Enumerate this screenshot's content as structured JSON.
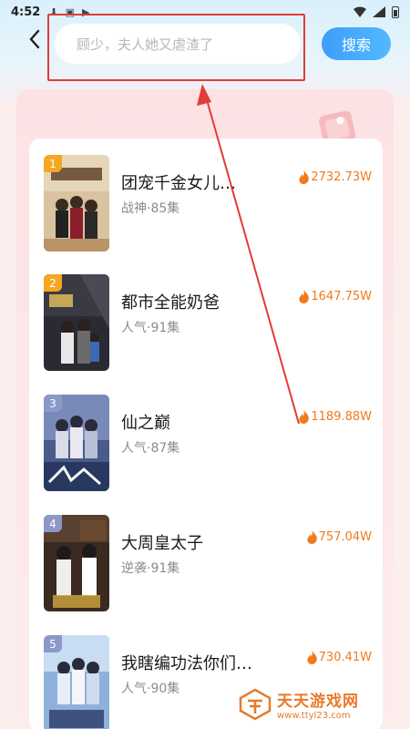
{
  "status_bar": {
    "time": "4:52"
  },
  "search": {
    "placeholder": "顾少，夫人她又虐渣了",
    "button_label": "搜索"
  },
  "ranking": [
    {
      "rank": "1",
      "title": "团宠千金女儿…",
      "meta": "战神·85集",
      "heat": "2732.73W",
      "badge_color": "#f5a623"
    },
    {
      "rank": "2",
      "title": "都市全能奶爸",
      "meta": "人气·91集",
      "heat": "1647.75W",
      "badge_color": "#f5a623"
    },
    {
      "rank": "3",
      "title": "仙之巅",
      "meta": "人气·87集",
      "heat": "1189.88W",
      "badge_color": "#8c98c8"
    },
    {
      "rank": "4",
      "title": "大周皇太子",
      "meta": "逆袭·91集",
      "heat": "757.04W",
      "badge_color": "#8c98c8"
    },
    {
      "rank": "5",
      "title": "我瞎编功法你们…",
      "meta": "人气·90集",
      "heat": "730.41W",
      "badge_color": "#8c98c8"
    }
  ],
  "colors": {
    "accent_blue": "#3f9dfa",
    "heat_orange": "#f07a1e",
    "annotation_red": "#e23b3b"
  },
  "watermark": {
    "title": "天天游戏网",
    "url": "www.ttyl23.com"
  }
}
